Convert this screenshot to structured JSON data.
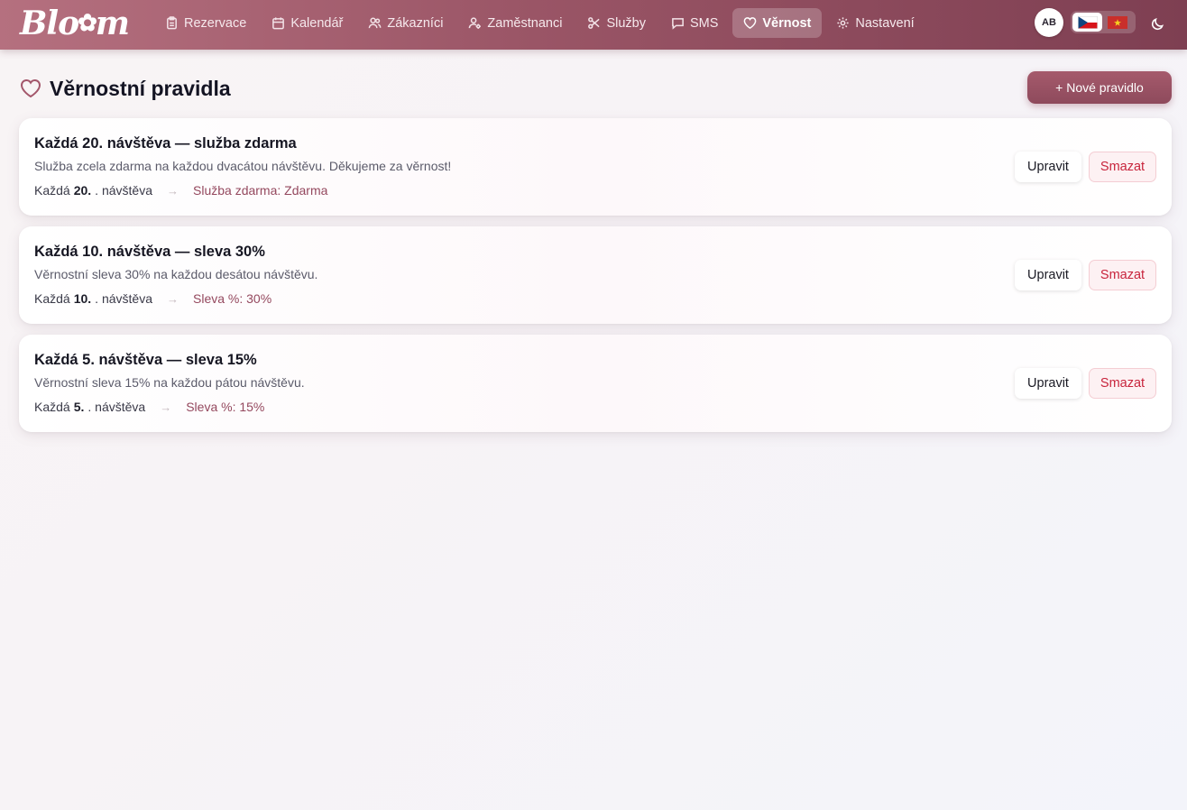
{
  "brand": {
    "logo_text_left": "Blo",
    "logo_flower": "✿",
    "logo_text_right": "m"
  },
  "nav": {
    "items": [
      {
        "label": "Rezervace",
        "icon": "clipboard-icon",
        "active": false
      },
      {
        "label": "Kalendář",
        "icon": "calendar-icon",
        "active": false
      },
      {
        "label": "Zákazníci",
        "icon": "users-icon",
        "active": false
      },
      {
        "label": "Zaměstnanci",
        "icon": "staff-icon",
        "active": false
      },
      {
        "label": "Služby",
        "icon": "scissors-icon",
        "active": false
      },
      {
        "label": "SMS",
        "icon": "message-icon",
        "active": false
      },
      {
        "label": "Věrnost",
        "icon": "heart-icon",
        "active": true
      },
      {
        "label": "Nastavení",
        "icon": "gear-icon",
        "active": false
      }
    ]
  },
  "user": {
    "initials": "AB"
  },
  "language": {
    "options": [
      "cs-flag-icon",
      "vn-flag-icon"
    ],
    "selected": "cs-flag-icon"
  },
  "page": {
    "title": "Věrnostní pravidla",
    "title_icon": "heart-icon",
    "new_rule_label": "+ Nové pravidlo"
  },
  "rules": [
    {
      "title": "Každá 20. návštěva — služba zdarma",
      "description": "Služba zcela zdarma na každou dvacátou návštěvu. Děkujeme za věrnost!",
      "meta_prefix": "Každá",
      "meta_number": "20.",
      "meta_suffix": ". návštěva",
      "reward": "Služba zdarma: Zdarma",
      "edit_label": "Upravit",
      "delete_label": "Smazat"
    },
    {
      "title": "Každá 10. návštěva — sleva 30%",
      "description": "Věrnostní sleva 30% na každou desátou návštěvu.",
      "meta_prefix": "Každá",
      "meta_number": "10.",
      "meta_suffix": ". návštěva",
      "reward": "Sleva %: 30%",
      "edit_label": "Upravit",
      "delete_label": "Smazat"
    },
    {
      "title": "Každá 5. návštěva — sleva 15%",
      "description": "Věrnostní sleva 15% na každou pátou návštěvu.",
      "meta_prefix": "Každá",
      "meta_number": "5.",
      "meta_suffix": ". návštěva",
      "reward": "Sleva %: 15%",
      "edit_label": "Upravit",
      "delete_label": "Smazat"
    }
  ],
  "colors": {
    "brand": "#9a5566",
    "accent": "#94485e",
    "danger": "#c8243c"
  }
}
